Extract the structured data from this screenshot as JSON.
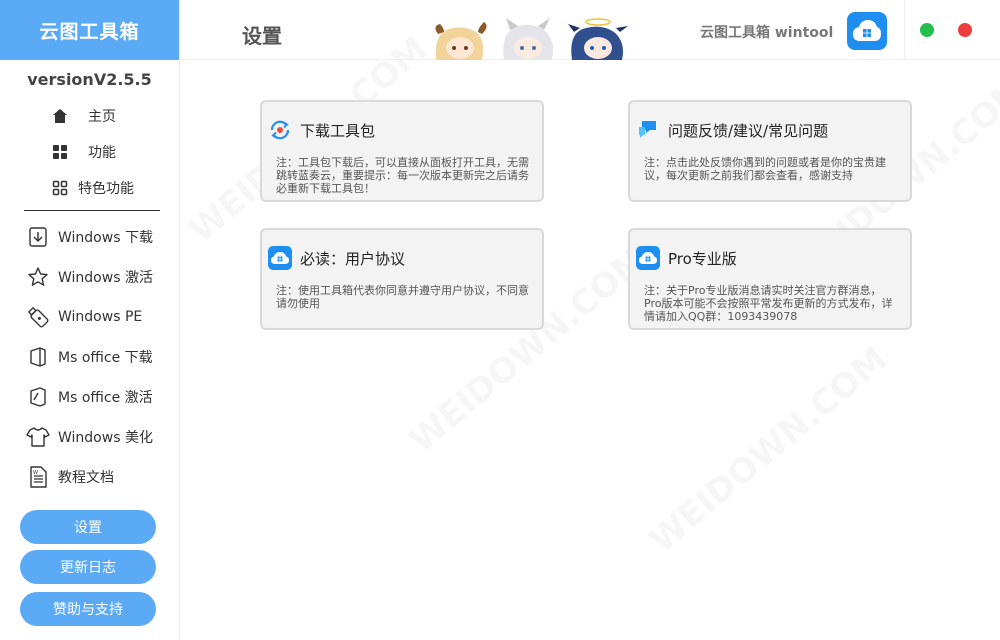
{
  "sidebar": {
    "brand": "云图工具箱",
    "version": "versionV2.5.5",
    "nav": [
      {
        "label": "主页",
        "icon": "home-icon"
      },
      {
        "label": "功能",
        "icon": "grid-icon"
      },
      {
        "label": "特色功能",
        "icon": "apps-icon"
      }
    ],
    "tools": [
      {
        "label": "Windows 下载",
        "icon": "download-icon"
      },
      {
        "label": "Windows 激活",
        "icon": "star-icon"
      },
      {
        "label": "Windows PE",
        "icon": "usb-drive-icon"
      },
      {
        "label": "Ms office 下载",
        "icon": "office-icon"
      },
      {
        "label": "Ms office 激活",
        "icon": "office-activate-icon"
      },
      {
        "label": "Windows 美化",
        "icon": "tshirt-icon"
      },
      {
        "label": "教程文档",
        "icon": "document-icon"
      }
    ],
    "buttons": {
      "settings": "设置",
      "changelog": "更新日志",
      "support": "赞助与支持"
    }
  },
  "header": {
    "title": "设置",
    "app_name": "云图工具箱 wintool"
  },
  "cards": [
    {
      "title": "下载工具包",
      "icon": "refresh-icon",
      "note": "注：工具包下载后，可以直接从面板打开工具，无需跳转蓝奏云，重要提示：每一次版本更新完之后请务必重新下载工具包！"
    },
    {
      "title": "问题反馈/建议/常见问题",
      "icon": "feedback-icon",
      "note": "注：点击此处反馈你遇到的问题或者是你的宝贵建议，每次更新之前我们都会查看，感谢支持"
    },
    {
      "title": "必读：用户协议",
      "icon": "cloud-logo-icon",
      "note": "注：使用工具箱代表你同意并遵守用户协议，不同意请勿使用"
    },
    {
      "title": "Pro专业版",
      "icon": "cloud-logo-icon",
      "note": "注：关于Pro专业版消息请实时关注官方群消息，Pro版本可能不会按照平常发布更新的方式发布，详情请加入QQ群：1093439078"
    }
  ],
  "watermark": "WEIDOWN.COM",
  "colors": {
    "accent": "#5aaaf5",
    "logo_blue": "#1e8ef0",
    "window_green": "#22c04a",
    "window_red": "#ee3b3b"
  }
}
